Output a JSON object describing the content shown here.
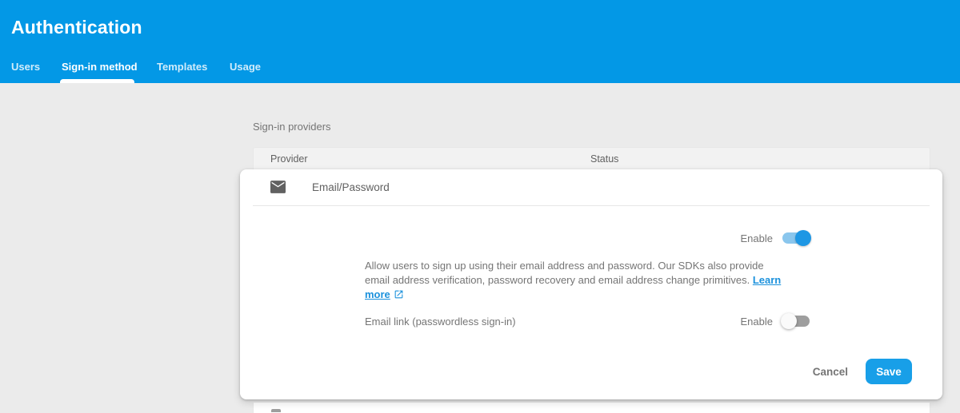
{
  "header": {
    "title": "Authentication",
    "tabs": [
      {
        "label": "Users",
        "active": false
      },
      {
        "label": "Sign-in method",
        "active": true
      },
      {
        "label": "Templates",
        "active": false
      },
      {
        "label": "Usage",
        "active": false
      }
    ]
  },
  "main": {
    "section_label": "Sign-in providers",
    "table": {
      "columns": {
        "provider": "Provider",
        "status": "Status"
      }
    },
    "provider_card": {
      "provider": {
        "name": "Email/Password",
        "icon": "email-icon"
      },
      "email_password": {
        "enable_label": "Enable",
        "enabled": true,
        "description_line1": "Allow users to sign up using their email address and password. Our SDKs also provide email",
        "description_line2": "address verification, password recovery and email address change primitives.",
        "learn_more_label": "Learn more",
        "learn_more_icon": "external-link-icon"
      },
      "email_link": {
        "label": "Email link (passwordless sign-in)",
        "enable_label": "Enable",
        "enabled": false
      },
      "actions": {
        "cancel_label": "Cancel",
        "save_label": "Save"
      }
    }
  },
  "colors": {
    "header_background": "#0398E6",
    "page_background": "#EBEBEB",
    "accent_blue": "#189FE8",
    "link_blue": "#1B91DC",
    "toggle_on_track": "#8AC6ED",
    "toggle_on_thumb": "#1E97E4",
    "toggle_off_track": "#9E9E9E",
    "text_gray": "#757575"
  }
}
